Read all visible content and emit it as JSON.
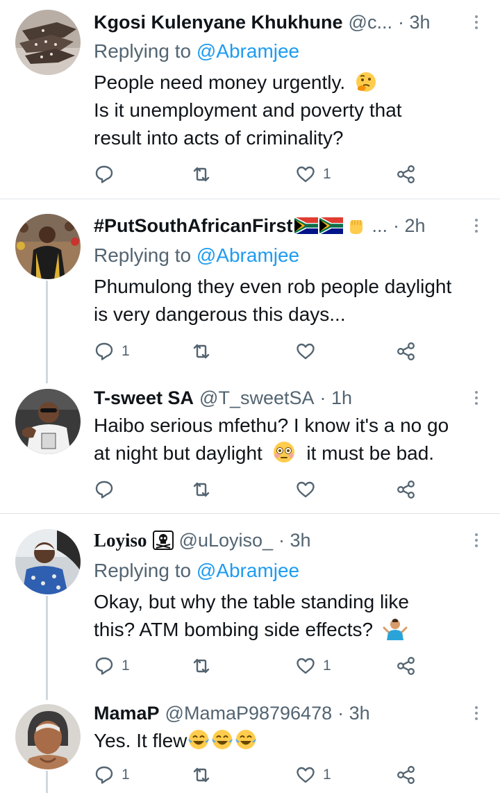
{
  "tweets": [
    {
      "name": "Kgosi Kulenyane Khukhune",
      "handle": "@c...",
      "time": "· 3h",
      "replying_prefix": "Replying to",
      "replying_to": "@Abramjee",
      "lines": [
        "People need money urgently.",
        "Is it unemployment and poverty that",
        "result into acts of criminality?"
      ],
      "reply_count": "",
      "like_count": "1",
      "emoji_icon": "thinking-face-icon"
    },
    {
      "name": "#PutSouthAfricanFirst",
      "handle": "...",
      "time": "· 2h",
      "replying_prefix": "Replying to",
      "replying_to": "@Abramjee",
      "lines": [
        "Phumulong they even rob people daylight",
        "is very dangerous this days..."
      ],
      "reply_count": "1",
      "like_count": ""
    },
    {
      "name": "T-sweet SA",
      "handle": "@T_sweetSA",
      "time": "· 1h",
      "lines": [
        "Haibo serious mfethu? I know it's a no go",
        "at night but daylight",
        "it must be bad."
      ],
      "reply_count": "",
      "like_count": ""
    },
    {
      "name": "Loyiso",
      "handle": "@uLoyiso_",
      "time": "· 3h",
      "replying_prefix": "Replying to",
      "replying_to": "@Abramjee",
      "lines": [
        "Okay, but why the table standing like",
        "this? ATM bombing side effects?"
      ],
      "reply_count": "1",
      "like_count": "1"
    },
    {
      "name": "MamaP",
      "handle": "@MamaP98796478",
      "time": "· 3h",
      "lines": [
        "Yes. It flew"
      ],
      "reply_count": "1",
      "like_count": "1"
    }
  ],
  "colors": {
    "text": "#0f1419",
    "secondary": "#536471",
    "link": "#1d9bf0",
    "divider": "#dfe3e6",
    "thread_line": "#cfd9de"
  }
}
